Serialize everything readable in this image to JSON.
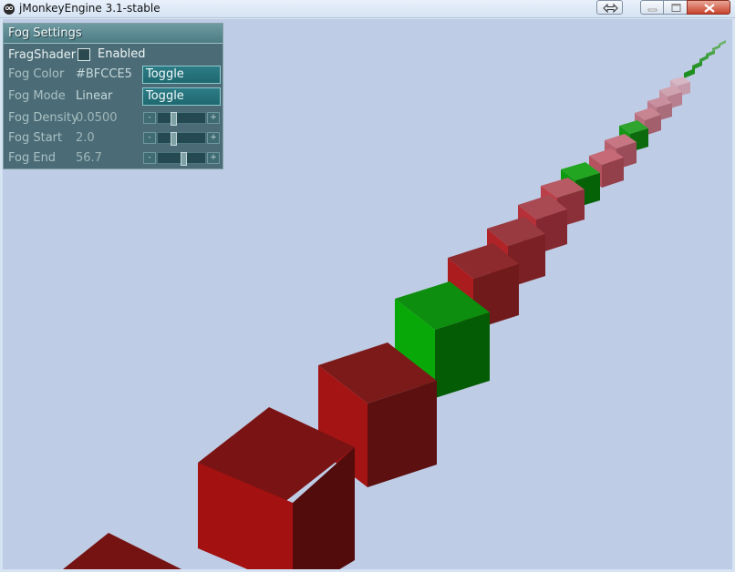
{
  "window": {
    "title": "jMonkeyEngine 3.1-stable",
    "buttons": [
      "swap-size",
      "minimize",
      "maximize",
      "close"
    ]
  },
  "scene": {
    "background_color": "#BFCCE5",
    "box_colors": {
      "red": "#a11515",
      "green": "#0aa00a"
    }
  },
  "fog_panel": {
    "title": "Fog Settings",
    "frag_shader": {
      "label": "FragShader",
      "checkbox_label": "Enabled",
      "checked": false
    },
    "fog_color": {
      "label": "Fog Color",
      "value": "#BFCCE5",
      "button": "Toggle"
    },
    "fog_mode": {
      "label": "Fog Mode",
      "value": "Linear",
      "button": "Toggle"
    },
    "fog_density": {
      "label": "Fog Density",
      "value": "0.0500",
      "slider_fraction": 0.32
    },
    "fog_start": {
      "label": "Fog Start",
      "value": "2.0",
      "slider_fraction": 0.32
    },
    "fog_end": {
      "label": "Fog End",
      "value": "56.7",
      "slider_fraction": 0.56
    },
    "slider_minus": "-",
    "slider_plus": "+"
  }
}
